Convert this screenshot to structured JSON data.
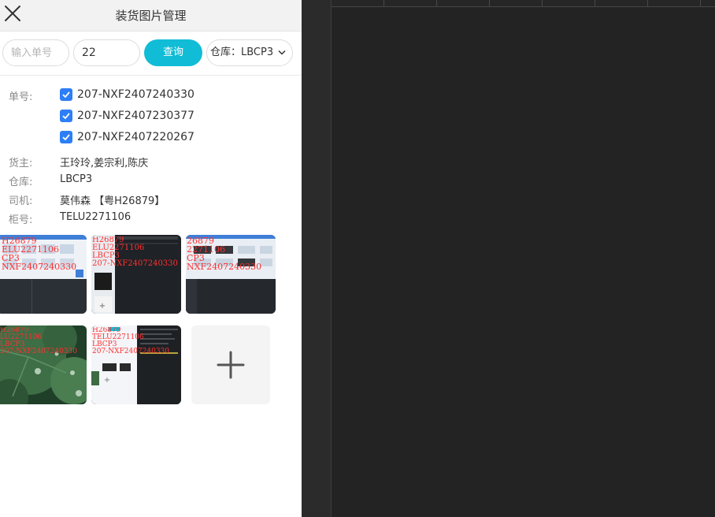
{
  "header": {
    "title": "装货图片管理",
    "close_icon": "close-icon"
  },
  "search": {
    "order_placeholder": "输入单号",
    "qty_value": "22",
    "query_label": "查询",
    "warehouse_label": "仓库：LBCP3"
  },
  "details": {
    "order_label": "单号:",
    "orders": [
      "207-NXF2407240330",
      "207-NXF2407230377",
      "207-NXF2407220267"
    ],
    "owner_label": "货主:",
    "owner_value": "王玲玲,姜宗利,陈庆",
    "warehouse_label": "仓库:",
    "warehouse_value": "LBCP3",
    "driver_label": "司机:",
    "driver_value": "莫伟森 【粤H26879】",
    "container_label": "柜号:",
    "container_value": "TELU2271106"
  },
  "photos": {
    "p1": [
      "H26879",
      "ELU2271106",
      "CP3",
      "NXF2407240330"
    ],
    "p2": [
      "H26879",
      "ELU2271106",
      "LBCP3",
      "207-NXF2407240330"
    ],
    "p3": [
      "26879",
      "2271106",
      "CP3",
      "NXF2407240330"
    ],
    "p4": [
      "H26879",
      "LU2271106",
      "LBCP3",
      "207-NXF2407240330"
    ],
    "p5": [
      "H26879",
      "TELU2271106",
      "LBCP3",
      "207-NXF2407240330"
    ]
  },
  "colors": {
    "accent": "#11bcd6",
    "checkbox": "#2d7ef7",
    "watermark": "#ff3030"
  }
}
